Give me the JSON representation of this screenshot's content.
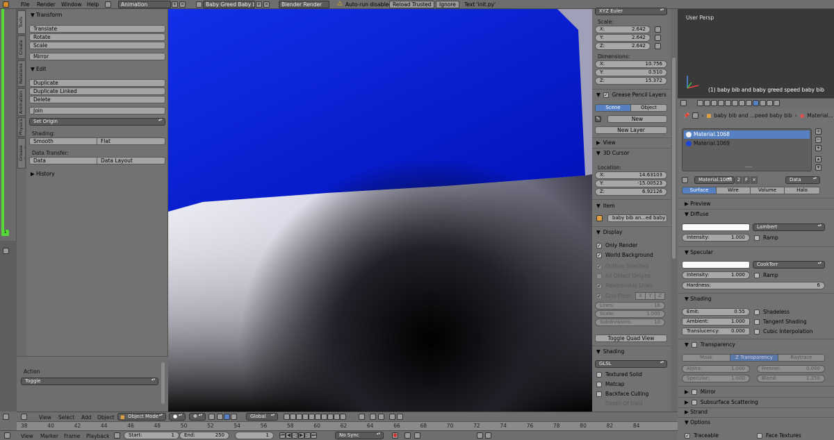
{
  "menu": {
    "file": "File",
    "render": "Render",
    "window": "Window",
    "help": "Help"
  },
  "topbar": {
    "layout": "Animation",
    "scene": "Baby Greed Baby bib",
    "engine": "Blender Render",
    "autorun": "Auto-run disabled",
    "reload": "Reload Trusted",
    "ignore": "Ignore",
    "text": "Text 'init.py'"
  },
  "left_tabs": [
    "Tools",
    "Create",
    "Relations",
    "Animation",
    "Physics",
    "Grease Pencil"
  ],
  "tools": {
    "transform": {
      "title": "Transform",
      "translate": "Translate",
      "rotate": "Rotate",
      "scale": "Scale",
      "mirror": "Mirror"
    },
    "edit": {
      "title": "Edit",
      "duplicate": "Duplicate",
      "duplicate_linked": "Duplicate Linked",
      "delete": "Delete",
      "join": "Join",
      "set_origin": "Set Origin",
      "shading_label": "Shading:",
      "smooth": "Smooth",
      "flat": "Flat",
      "data_transfer_label": "Data Transfer:",
      "data": "Data",
      "data_layout": "Data Layout"
    },
    "history": "History",
    "action_label": "Action",
    "action_value": "Toggle",
    "frame_number": "1"
  },
  "npanel": {
    "rotation_mode": "XYZ Euler",
    "scale_label": "Scale:",
    "scale": {
      "x": "2.642",
      "y": "2.642",
      "z": "2.642"
    },
    "dimensions_label": "Dimensions:",
    "dimensions": {
      "x": "10.756",
      "y": "0.510",
      "z": "15.372"
    },
    "axis": {
      "x": "X:",
      "y": "Y:",
      "z": "Z:"
    },
    "grease_pencil_layers": "Grease Pencil Layers",
    "scene_tab": "Scene",
    "object_tab": "Object",
    "new": "New",
    "new_layer": "New Layer",
    "view": "View",
    "cursor": "3D Cursor",
    "location_label": "Location:",
    "location": {
      "x": "14.63103",
      "y": "-15.00523",
      "z": "6.92126"
    },
    "item": "Item",
    "item_name": "baby bib an...ed baby bib",
    "display": "Display",
    "only_render": "Only Render",
    "world_background": "World Background",
    "outline_selected": "Outline Selected",
    "all_object_origins": "All Object Origins",
    "relationship_lines": "Relationship Lines",
    "grid_floor": "Grid Floor",
    "gx": "X",
    "gy": "Y",
    "gz": "Z",
    "lines_label": "Lines:",
    "lines": "16",
    "scale_f_label": "Scale:",
    "scale_f": "1.000",
    "subdivisions_label": "Subdivisions:",
    "subdivisions": "10",
    "toggle_quad": "Toggle Quad View",
    "shading": "Shading",
    "shading_mode": "GLSL",
    "textured_solid": "Textured Solid",
    "matcap": "Matcap",
    "backface_culling": "Backface Culling",
    "depth_of_field": "Depth Of Field"
  },
  "viewport_small": {
    "title": "User Persp",
    "object_label": "(1) baby bib and baby greed speed baby bib"
  },
  "properties": {
    "breadcrumb_object": "baby bib and ...peed baby bib",
    "breadcrumb_material": "Material...",
    "slots": [
      {
        "name": "Material.1068",
        "color": "#f2f2f2"
      },
      {
        "name": "Material.1069",
        "color": "#1f44d8"
      }
    ],
    "material_name": "Material.1068",
    "users": "2",
    "fake": "F",
    "link": "Data",
    "tabs": [
      "Surface",
      "Wire",
      "Volume",
      "Halo"
    ],
    "preview": "Preview",
    "diffuse": "Diffuse",
    "diffuse_shader": "Lambert",
    "intensity_label": "Intensity:",
    "diffuse_intensity": "1.000",
    "ramp": "Ramp",
    "specular": "Specular",
    "specular_shader": "CookTorr",
    "specular_intensity": "1.000",
    "hardness_label": "Hardness:",
    "hardness": "6",
    "shading": "Shading",
    "emit_label": "Emit:",
    "emit": "0.55",
    "ambient_label": "Ambient:",
    "ambient": "1.000",
    "translucency_label": "Translucency:",
    "translucency": "0.000",
    "shadeless": "Shadeless",
    "tangent_shading": "Tangent Shading",
    "cubic_interpolation": "Cubic Interpolation",
    "transparency": "Transparency",
    "trans_tabs": [
      "Mask",
      "Z Transparency",
      "Raytrace"
    ],
    "alpha_label": "Alpha:",
    "alpha": "1.000",
    "fresnel_label": "Fresnel:",
    "fresnel": "0.000",
    "specular_t_label": "Specular:",
    "specular_t": "1.000",
    "blend_label": "Blend:",
    "blend": "1.250",
    "mirror": "Mirror",
    "sss": "Subsurface Scattering",
    "strand": "Strand",
    "options": "Options",
    "traceable": "Traceable",
    "face_textures": "Face Textures"
  },
  "vp_header": {
    "view": "View",
    "select": "Select",
    "add": "Add",
    "object": "Object",
    "mode": "Object Mode",
    "orientation": "Global"
  },
  "timeline_ticks": [
    "38",
    "40",
    "42",
    "44",
    "46",
    "48",
    "50",
    "52",
    "54",
    "56",
    "58",
    "60",
    "62",
    "64",
    "66",
    "68",
    "70",
    "72",
    "74",
    "76",
    "78",
    "80",
    "82",
    "84"
  ],
  "bottom": {
    "view": "View",
    "marker": "Marker",
    "frame": "Frame",
    "playback": "Playback",
    "start_label": "Start:",
    "start": "1",
    "end_label": "End:",
    "end": "250",
    "current": "1",
    "sync": "No Sync"
  },
  "colors": {
    "selected": "#5680c2",
    "blue_area": "#0a1fd6",
    "header": "#6e6e6e",
    "panel": "#727272"
  }
}
